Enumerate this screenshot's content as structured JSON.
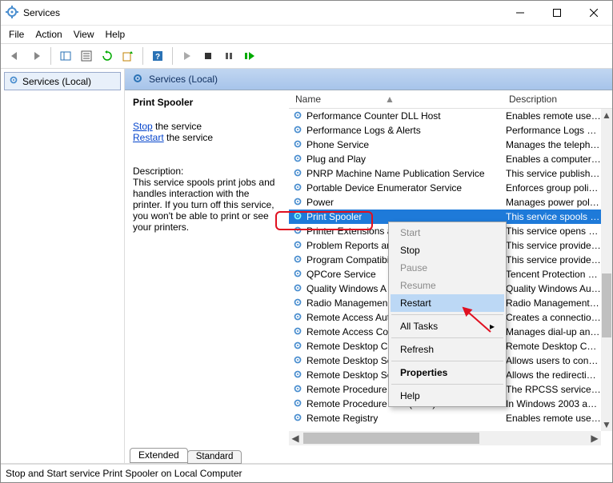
{
  "window": {
    "title": "Services"
  },
  "menu": {
    "items": [
      "File",
      "Action",
      "View",
      "Help"
    ]
  },
  "left": {
    "root": "Services (Local)"
  },
  "right_header": {
    "label": "Services (Local)"
  },
  "detail": {
    "heading": "Print Spooler",
    "stop_link": "Stop",
    "stop_text": " the service",
    "restart_link": "Restart",
    "restart_text": " the service",
    "desc_label": "Description:",
    "desc_text": "This service spools print jobs and handles interaction with the printer. If you turn off this service, you won't be able to print or see your printers."
  },
  "columns": {
    "name": "Name",
    "desc": "Description"
  },
  "services": [
    {
      "name": "Performance Counter DLL Host",
      "desc": "Enables remote users a..."
    },
    {
      "name": "Performance Logs & Alerts",
      "desc": "Performance Logs and..."
    },
    {
      "name": "Phone Service",
      "desc": "Manages the telephon..."
    },
    {
      "name": "Plug and Play",
      "desc": "Enables a computer to ..."
    },
    {
      "name": "PNRP Machine Name Publication Service",
      "desc": "This service publishes ..."
    },
    {
      "name": "Portable Device Enumerator Service",
      "desc": "Enforces group policy f..."
    },
    {
      "name": "Power",
      "desc": "Manages power policy ..."
    },
    {
      "name": "Print Spooler",
      "desc": "This service spools prin...",
      "selected": true
    },
    {
      "name": "Printer Extensions a",
      "desc": "This service opens cust..."
    },
    {
      "name": "Problem Reports an",
      "desc": "This service provides s..."
    },
    {
      "name": "Program Compatibi",
      "desc": "This service provides s..."
    },
    {
      "name": "QPCore Service",
      "desc": "Tencent Protection Ser..."
    },
    {
      "name": "Quality Windows A",
      "desc": "Quality Windows Audi..."
    },
    {
      "name": "Radio Managemen",
      "desc": "Radio Management an..."
    },
    {
      "name": "Remote Access Aut",
      "desc": "Creates a connection t..."
    },
    {
      "name": "Remote Access Co",
      "desc": "Manages dial-up and v..."
    },
    {
      "name": "Remote Desktop C",
      "desc": "Remote Desktop Confi..."
    },
    {
      "name": "Remote Desktop Se",
      "desc": "Allows users to connec..."
    },
    {
      "name": "Remote Desktop Se",
      "desc": "Allows the redirection ..."
    },
    {
      "name": "Remote Procedure",
      "desc": "The RPCSS service is th..."
    },
    {
      "name": "Remote Procedure Call (RPC) Locator",
      "desc": "In Windows 2003 and e..."
    },
    {
      "name": "Remote Registry",
      "desc": "Enables remote users t..."
    }
  ],
  "context_menu": {
    "start": "Start",
    "stop": "Stop",
    "pause": "Pause",
    "resume": "Resume",
    "restart": "Restart",
    "all_tasks": "All Tasks",
    "refresh": "Refresh",
    "properties": "Properties",
    "help": "Help"
  },
  "tabs": {
    "extended": "Extended",
    "standard": "Standard"
  },
  "statusbar": {
    "text": "Stop and Start service Print Spooler on Local Computer"
  }
}
